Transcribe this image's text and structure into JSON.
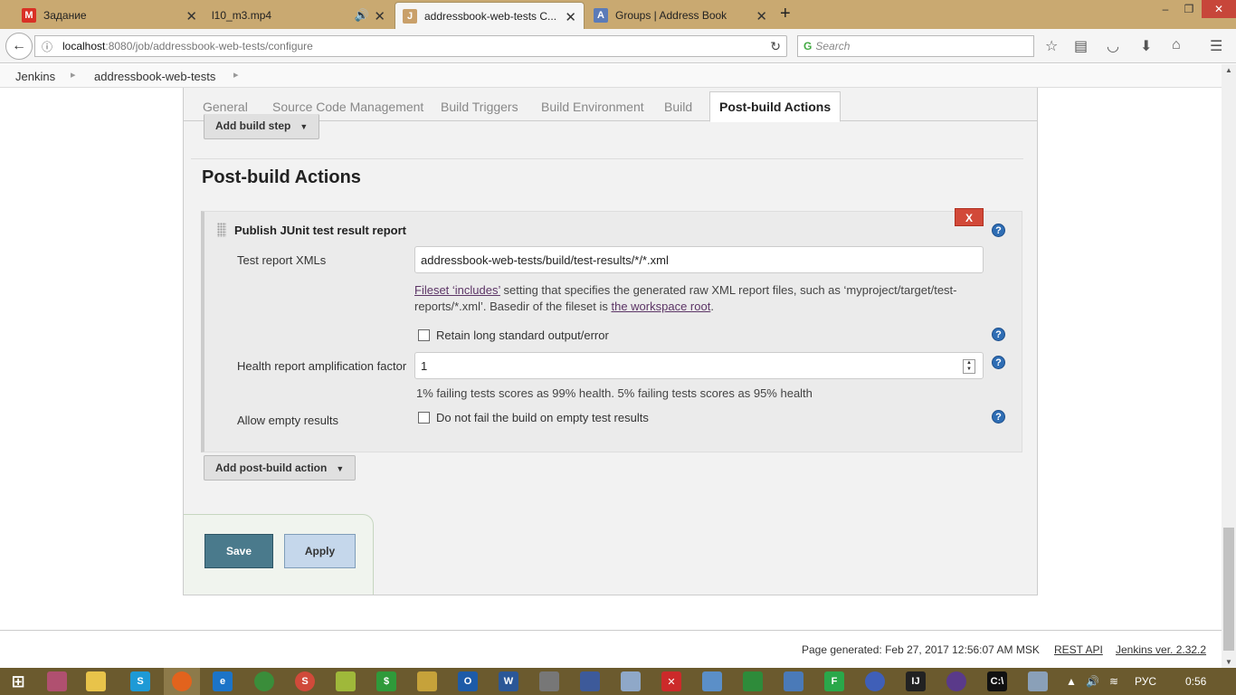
{
  "browser": {
    "tabs": [
      {
        "title": "Задание",
        "favicon": "М",
        "color": "#d93025",
        "active": false
      },
      {
        "title": "l10_m3.mp4",
        "favicon": "",
        "color": "#c9a971",
        "active": false
      },
      {
        "title": "addressbook-web-tests C...",
        "favicon": "J",
        "color": "#c9a06a",
        "active": true
      },
      {
        "title": "Groups | Address Book",
        "favicon": "A",
        "color": "#5b7bb8",
        "active": false
      }
    ],
    "url_host": "localhost",
    "url_path": ":8080/job/addressbook-web-tests/configure",
    "search_placeholder": "Search"
  },
  "breadcrumbs": {
    "root": "Jenkins",
    "job": "addressbook-web-tests"
  },
  "config_tabs": {
    "general": "General",
    "scm": "Source Code Management",
    "triggers": "Build Triggers",
    "environment": "Build Environment",
    "build": "Build",
    "post_build": "Post-build Actions"
  },
  "add_build_step": "Add build step",
  "section_title": "Post-build Actions",
  "publisher": {
    "title": "Publish JUnit test result report",
    "delete_label": "X",
    "help_label": "?",
    "test_report_label": "Test report XMLs",
    "test_report_value": "addressbook-web-tests/build/test-results/*/*.xml",
    "desc_link1": "Fileset ‘includes’",
    "desc_text1": " setting that specifies the generated raw XML report files, such as ‘myproject/target/test-reports/*.xml’. Basedir of the fileset is ",
    "desc_link2": "the workspace root",
    "desc_text2": ".",
    "retain_label": "Retain long standard output/error",
    "health_label": "Health report amplification factor",
    "health_value": "1",
    "health_desc": "1% failing tests scores as 99% health. 5% failing tests scores as 95% health",
    "allow_empty_label": "Allow empty results",
    "allow_empty_check": "Do not fail the build on empty test results"
  },
  "add_post_build": "Add post-build action",
  "buttons": {
    "save": "Save",
    "apply": "Apply"
  },
  "footer": {
    "generated": "Page generated: Feb 27, 2017 12:56:07 AM MSK",
    "rest_api": "REST API",
    "version": "Jenkins ver. 2.32.2"
  },
  "taskbar": {
    "lang": "РУС",
    "time": "0:56"
  }
}
